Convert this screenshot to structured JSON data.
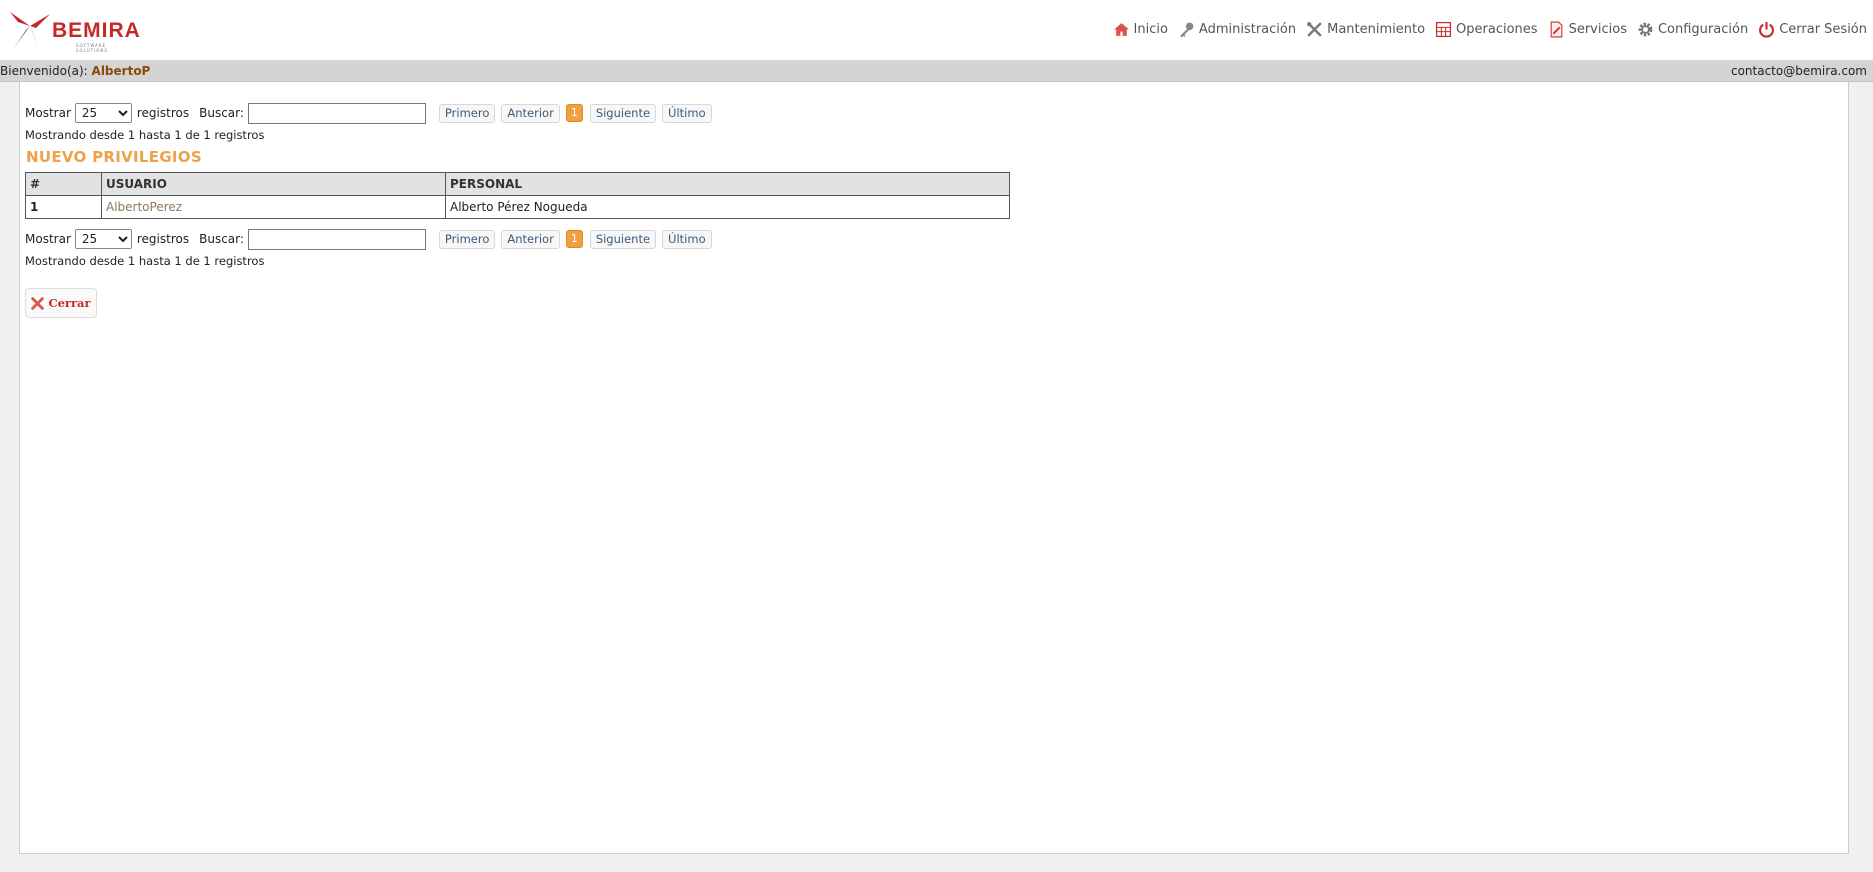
{
  "brand": {
    "name": "BEMIRA",
    "tagline": "SOFTWARE SOLUTIONS"
  },
  "nav": [
    {
      "label": "Inicio",
      "icon": "home-icon"
    },
    {
      "label": "Administración",
      "icon": "key-icon"
    },
    {
      "label": "Mantenimiento",
      "icon": "tools-icon"
    },
    {
      "label": "Operaciones",
      "icon": "grid-icon"
    },
    {
      "label": "Servicios",
      "icon": "document-edit-icon"
    },
    {
      "label": "Configuración",
      "icon": "gear-icon"
    },
    {
      "label": "Cerrar Sesión",
      "icon": "power-icon"
    }
  ],
  "welcome": {
    "prefix": "Bienvenido(a):",
    "user": "AlbertoP",
    "email": "contacto@bemira.com"
  },
  "listing": {
    "show_label": "Mostrar",
    "page_size": "25",
    "page_size_options": [
      "25"
    ],
    "records_label": "registros",
    "search_label": "Buscar:",
    "search_value": "",
    "first": "Primero",
    "prev": "Anterior",
    "current_page": "1",
    "next": "Siguiente",
    "last": "Último",
    "info": "Mostrando desde 1 hasta 1 de 1 registros"
  },
  "section_title": "NUEVO PRIVILEGIOS",
  "table": {
    "headers": [
      "#",
      "USUARIO",
      "PERSONAL"
    ],
    "rows": [
      [
        "1",
        "AlbertoPerez",
        "Alberto Pérez Nogueda"
      ]
    ]
  },
  "close_label": "Cerrar",
  "colors": {
    "accent": "#f0a048",
    "brand": "#c62828",
    "page_badge": "#f0a040"
  }
}
